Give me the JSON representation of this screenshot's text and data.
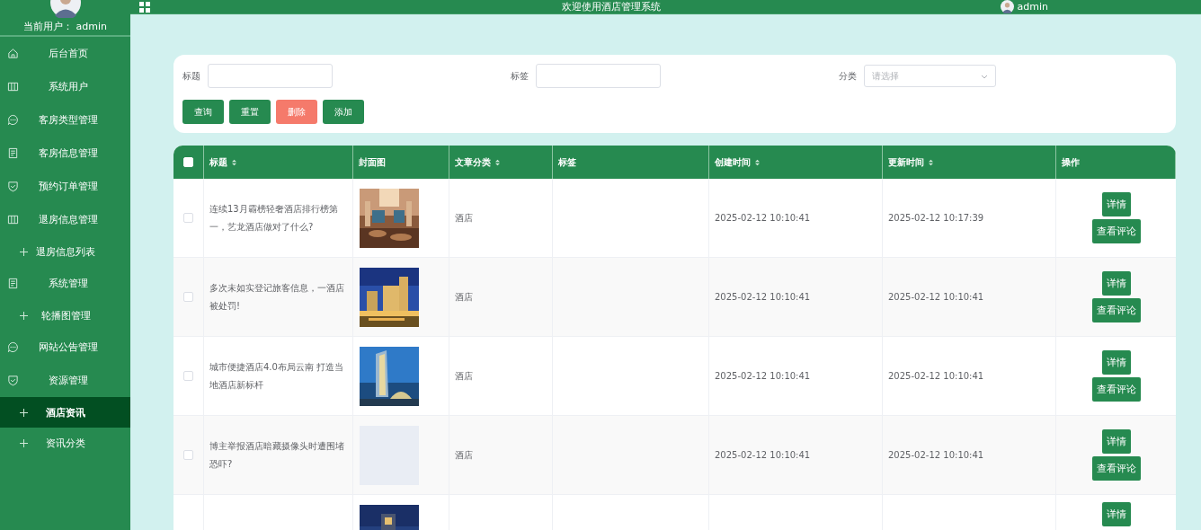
{
  "sidebar": {
    "user_label": "当前用户： admin",
    "items": [
      {
        "label": "后台首页",
        "selected": false
      },
      {
        "label": "系统用户",
        "selected": false
      },
      {
        "label": "客房类型管理",
        "selected": false
      },
      {
        "label": "客房信息管理",
        "selected": false
      },
      {
        "label": "预约订单管理",
        "selected": false
      },
      {
        "label": "退房信息管理",
        "selected": false,
        "children": [
          {
            "label": "退房信息列表",
            "selected": false
          }
        ]
      },
      {
        "label": "系统管理",
        "selected": false,
        "children": [
          {
            "label": "轮播图管理",
            "selected": false
          }
        ]
      },
      {
        "label": "网站公告管理",
        "selected": false
      },
      {
        "label": "资源管理",
        "selected": false,
        "children": [
          {
            "label": "酒店资讯",
            "selected": true
          },
          {
            "label": "资讯分类",
            "selected": false
          }
        ]
      }
    ]
  },
  "header": {
    "title": "欢迎使用酒店管理系统",
    "user": "admin"
  },
  "search": {
    "fields": [
      {
        "label": "标题",
        "kind": "input"
      },
      {
        "label": "标签",
        "kind": "input"
      },
      {
        "label": "分类",
        "kind": "select",
        "placeholder": "请选择"
      }
    ],
    "buttons": [
      {
        "label": "查询",
        "kind": "primary"
      },
      {
        "label": "重置",
        "kind": "primary"
      },
      {
        "label": "删除",
        "kind": "danger"
      },
      {
        "label": "添加",
        "kind": "primary"
      }
    ]
  },
  "table": {
    "select_all": {
      "checked": false
    },
    "columns": [
      {
        "label": "标题",
        "sortable": true
      },
      {
        "label": "封面图",
        "sortable": false
      },
      {
        "label": "文章分类",
        "sortable": true
      },
      {
        "label": "标签",
        "sortable": false
      },
      {
        "label": "创建时间",
        "sortable": true
      },
      {
        "label": "更新时间",
        "sortable": true
      },
      {
        "label": "操作",
        "sortable": false
      }
    ],
    "rows": [
      {
        "checked": false,
        "title": "连续13月霸榜轻奢酒店排行榜第一，艺龙酒店做对了什么?",
        "cover": {
          "kind": "picture"
        },
        "category": "酒店",
        "created": "2025-02-12 10:10:41",
        "updated": "2025-02-12 10:17:39",
        "actions": [
          "详情",
          "查看评论"
        ]
      },
      {
        "checked": false,
        "title": "多次未如实登记旅客信息，一酒店被处罚!",
        "cover": {
          "kind": "picture"
        },
        "category": "酒店",
        "created": "2025-02-12 10:10:41",
        "updated": "2025-02-12 10:10:41",
        "actions": [
          "详情",
          "查看评论"
        ]
      },
      {
        "checked": false,
        "title": "城市便捷酒店4.0布局云南 打造当地酒店新标杆",
        "cover": {
          "kind": "picture"
        },
        "category": "酒店",
        "created": "2025-02-12 10:10:41",
        "updated": "2025-02-12 10:10:41",
        "actions": [
          "详情",
          "查看评论"
        ]
      },
      {
        "checked": false,
        "title": "博主举报酒店暗藏摄像头时遭围堵恐吓?",
        "cover": {
          "kind": "empty"
        },
        "category": "酒店",
        "created": "2025-02-12 10:10:41",
        "updated": "2025-02-12 10:10:41",
        "actions": [
          "详情",
          "查看评论"
        ]
      },
      {
        "cover": {
          "kind": "picture"
        },
        "actions": [
          "详情"
        ]
      }
    ]
  }
}
